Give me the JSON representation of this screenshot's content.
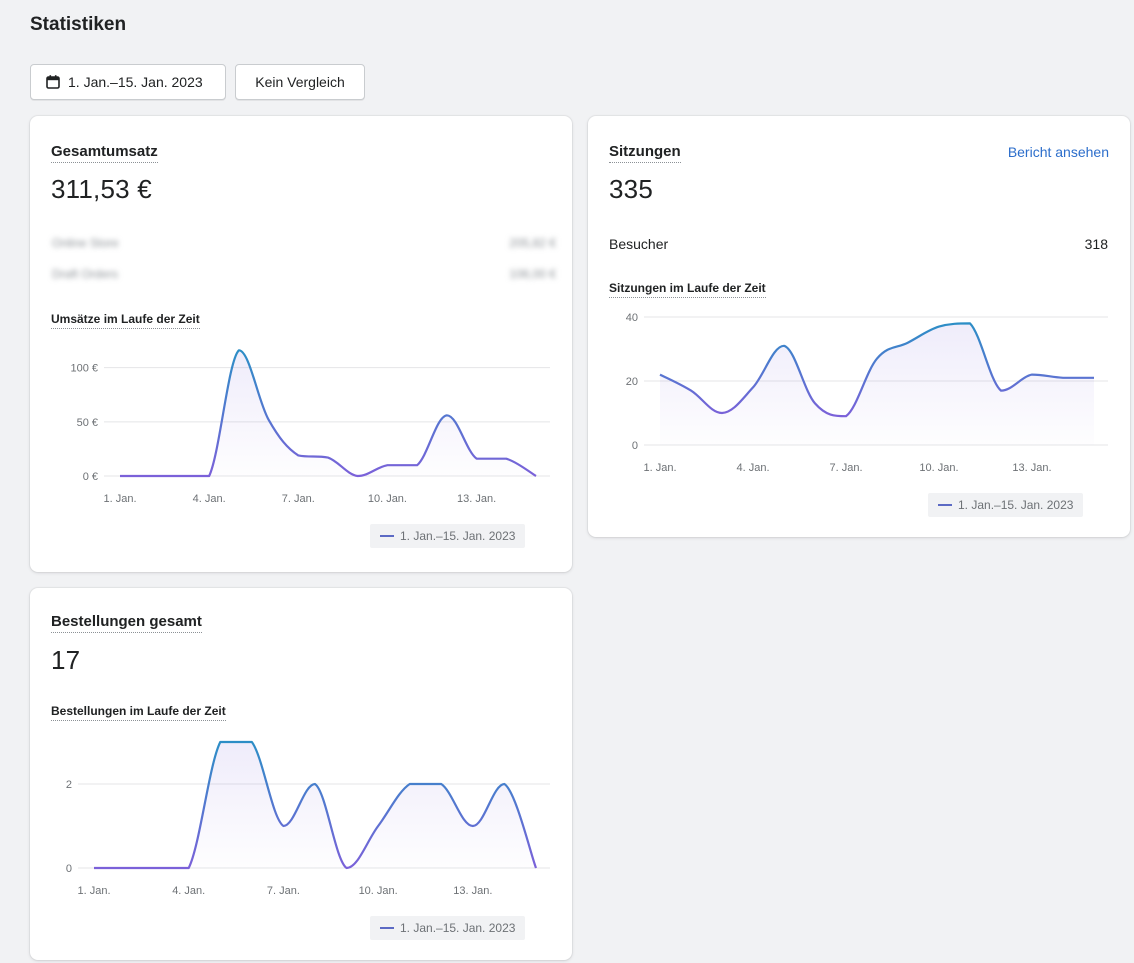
{
  "page": {
    "title": "Statistiken"
  },
  "toolbar": {
    "date_range_label": "1. Jan.–15. Jan. 2023",
    "date_icon": "calendar-icon",
    "compare_label": "Kein Vergleich"
  },
  "colors": {
    "line_start": "#2c8ec6",
    "line_end": "#7b61d9",
    "accent_link": "#2c6ecb"
  },
  "revenue_card": {
    "title": "Gesamtumsatz",
    "value": "311,53 €",
    "blurred_rows": [
      {
        "label": "Online Store",
        "value": "205,82 €"
      },
      {
        "label": "Draft Orders",
        "value": "106,00 €"
      }
    ],
    "chart_title": "Umsätze im Laufe der Zeit",
    "legend": "1. Jan.–15. Jan. 2023"
  },
  "sessions_card": {
    "title": "Sitzungen",
    "link": "Bericht ansehen",
    "value": "335",
    "visitors_label": "Besucher",
    "visitors_value": "318",
    "chart_title": "Sitzungen im Laufe der Zeit",
    "legend": "1. Jan.–15. Jan. 2023"
  },
  "orders_card": {
    "title": "Bestellungen gesamt",
    "value": "17",
    "chart_title": "Bestellungen im Laufe der Zeit",
    "legend": "1. Jan.–15. Jan. 2023"
  },
  "chart_data": [
    {
      "type": "line",
      "x": [
        "1. Jan.",
        "2. Jan.",
        "3. Jan.",
        "4. Jan.",
        "5. Jan.",
        "6. Jan.",
        "7. Jan.",
        "8. Jan.",
        "9. Jan.",
        "10. Jan.",
        "11. Jan.",
        "12. Jan.",
        "13. Jan.",
        "14. Jan.",
        "15. Jan."
      ],
      "x_tick_labels": [
        "1. Jan.",
        "4. Jan.",
        "7. Jan.",
        "10. Jan.",
        "13. Jan."
      ],
      "y_tick_labels": [
        "0 €",
        "50 €",
        "100 €"
      ],
      "y_ticks": [
        0,
        50,
        100
      ],
      "ylim": [
        0,
        120
      ],
      "series": [
        {
          "name": "1. Jan.–15. Jan. 2023",
          "values": [
            0,
            0,
            0,
            0,
            116,
            52,
            19,
            17,
            0,
            10,
            10,
            56,
            16,
            16,
            0
          ]
        }
      ]
    },
    {
      "type": "line",
      "x": [
        "1. Jan.",
        "2. Jan.",
        "3. Jan.",
        "4. Jan.",
        "5. Jan.",
        "6. Jan.",
        "7. Jan.",
        "8. Jan.",
        "9. Jan.",
        "10. Jan.",
        "11. Jan.",
        "12. Jan.",
        "13. Jan.",
        "14. Jan.",
        "15. Jan."
      ],
      "x_tick_labels": [
        "1. Jan.",
        "4. Jan.",
        "7. Jan.",
        "10. Jan.",
        "13. Jan."
      ],
      "y_tick_labels": [
        "0",
        "20",
        "40"
      ],
      "y_ticks": [
        0,
        20,
        40
      ],
      "ylim": [
        0,
        40
      ],
      "series": [
        {
          "name": "1. Jan.–15. Jan. 2023",
          "values": [
            22,
            17,
            10,
            18,
            31,
            13,
            9,
            27,
            32,
            37,
            38,
            17,
            22,
            21,
            21
          ]
        }
      ]
    },
    {
      "type": "line",
      "x": [
        "1. Jan.",
        "2. Jan.",
        "3. Jan.",
        "4. Jan.",
        "5. Jan.",
        "6. Jan.",
        "7. Jan.",
        "8. Jan.",
        "9. Jan.",
        "10. Jan.",
        "11. Jan.",
        "12. Jan.",
        "13. Jan.",
        "14. Jan.",
        "15. Jan."
      ],
      "x_tick_labels": [
        "1. Jan.",
        "4. Jan.",
        "7. Jan.",
        "10. Jan.",
        "13. Jan."
      ],
      "y_tick_labels": [
        "0",
        "2"
      ],
      "y_ticks": [
        0,
        2
      ],
      "ylim": [
        0,
        3
      ],
      "series": [
        {
          "name": "1. Jan.–15. Jan. 2023",
          "values": [
            0,
            0,
            0,
            0,
            3,
            3,
            1,
            2,
            0,
            1,
            2,
            2,
            1,
            2,
            0
          ]
        }
      ]
    }
  ]
}
